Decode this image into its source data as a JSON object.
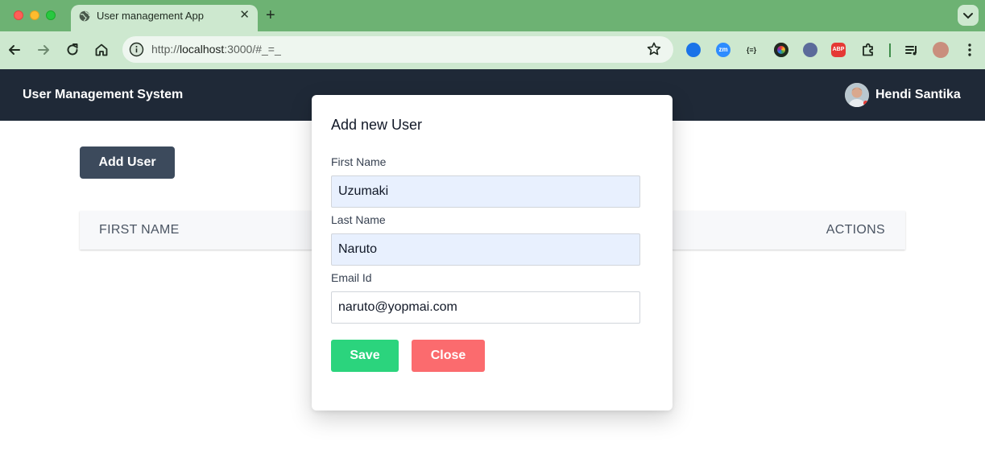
{
  "browser": {
    "tab_title": "User management App",
    "tab_close": "✕",
    "new_tab": "+",
    "url_prefix": "http://",
    "url_host": "localhost",
    "url_rest": ":3000/#_=_",
    "extensions": [
      {
        "name": "sync-extension",
        "color": "#1a73e8",
        "label": ""
      },
      {
        "name": "zoom-extension",
        "color": "#2d8cff",
        "label": "zm"
      },
      {
        "name": "json-extension",
        "color": "#e8f0e9",
        "label": "{≡}"
      },
      {
        "name": "color-picker-extension",
        "color": "#6b6b6b",
        "label": ""
      },
      {
        "name": "ghost-extension",
        "color": "#5b6b9a",
        "label": ""
      },
      {
        "name": "adblock-extension",
        "color": "#e53935",
        "label": "ABP"
      }
    ]
  },
  "header": {
    "title": "User Management System",
    "user_name": "Hendi Santika"
  },
  "main": {
    "add_user_label": "Add User",
    "table_headers": [
      "FIRST NAME",
      "ACTIONS"
    ]
  },
  "modal": {
    "title": "Add new User",
    "fields": {
      "first_name": {
        "label": "First Name",
        "value": "Uzumaki"
      },
      "last_name": {
        "label": "Last Name",
        "value": "Naruto"
      },
      "email": {
        "label": "Email Id",
        "value": "naruto@yopmai.com"
      }
    },
    "save_label": "Save",
    "close_label": "Close"
  },
  "colors": {
    "header_bg": "#1f2937",
    "save": "#2bd47d",
    "close": "#fb6b6e",
    "autofill": "#e8f0fe"
  }
}
